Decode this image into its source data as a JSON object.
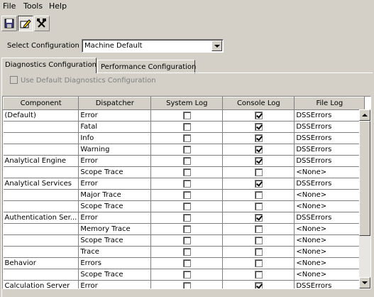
{
  "menu": [
    "File",
    "Tools",
    "Help"
  ],
  "toolbar": {
    "buttons": [
      {
        "icon": "save-icon"
      },
      {
        "icon": "edit-icon"
      },
      {
        "icon": "tools-icon"
      }
    ]
  },
  "config": {
    "label": "Select Configuration",
    "value": "Machine Default"
  },
  "tabs": [
    {
      "label": "Diagnostics Configuration",
      "active": true
    },
    {
      "label": "Performance Configuration",
      "active": false
    }
  ],
  "use_default_label": "Use Default Diagnostics Configuration",
  "grid": {
    "columns": [
      "Component",
      "Dispatcher",
      "System Log",
      "Console Log",
      "File Log"
    ],
    "rows": [
      {
        "component": "(Default)",
        "dispatcher": "Error",
        "system": false,
        "console": true,
        "file": "DSSErrors"
      },
      {
        "component": "",
        "dispatcher": "Fatal",
        "system": false,
        "console": true,
        "file": "DSSErrors"
      },
      {
        "component": "",
        "dispatcher": "Info",
        "system": false,
        "console": true,
        "file": "DSSErrors"
      },
      {
        "component": "",
        "dispatcher": "Warning",
        "system": false,
        "console": true,
        "file": "DSSErrors"
      },
      {
        "component": "Analytical Engine",
        "dispatcher": "Error",
        "system": false,
        "console": true,
        "file": "DSSErrors"
      },
      {
        "component": "",
        "dispatcher": "Scope Trace",
        "system": false,
        "console": false,
        "file": "<None>"
      },
      {
        "component": "Analytical Services",
        "dispatcher": "Error",
        "system": false,
        "console": true,
        "file": "DSSErrors"
      },
      {
        "component": "",
        "dispatcher": "Major Trace",
        "system": false,
        "console": false,
        "file": "<None>"
      },
      {
        "component": "",
        "dispatcher": "Scope Trace",
        "system": false,
        "console": false,
        "file": "<None>"
      },
      {
        "component": "Authentication Ser...",
        "dispatcher": "Error",
        "system": false,
        "console": true,
        "file": "DSSErrors"
      },
      {
        "component": "",
        "dispatcher": "Memory Trace",
        "system": false,
        "console": false,
        "file": "<None>"
      },
      {
        "component": "",
        "dispatcher": "Scope Trace",
        "system": false,
        "console": false,
        "file": "<None>"
      },
      {
        "component": "",
        "dispatcher": "Trace",
        "system": false,
        "console": false,
        "file": "<None>"
      },
      {
        "component": "Behavior",
        "dispatcher": "Errors",
        "system": false,
        "console": false,
        "file": "<None>"
      },
      {
        "component": "",
        "dispatcher": "Scope Trace",
        "system": false,
        "console": false,
        "file": "<None>"
      },
      {
        "component": "Calculation Server",
        "dispatcher": "Error",
        "system": false,
        "console": true,
        "file": "DSSErrors"
      }
    ]
  }
}
